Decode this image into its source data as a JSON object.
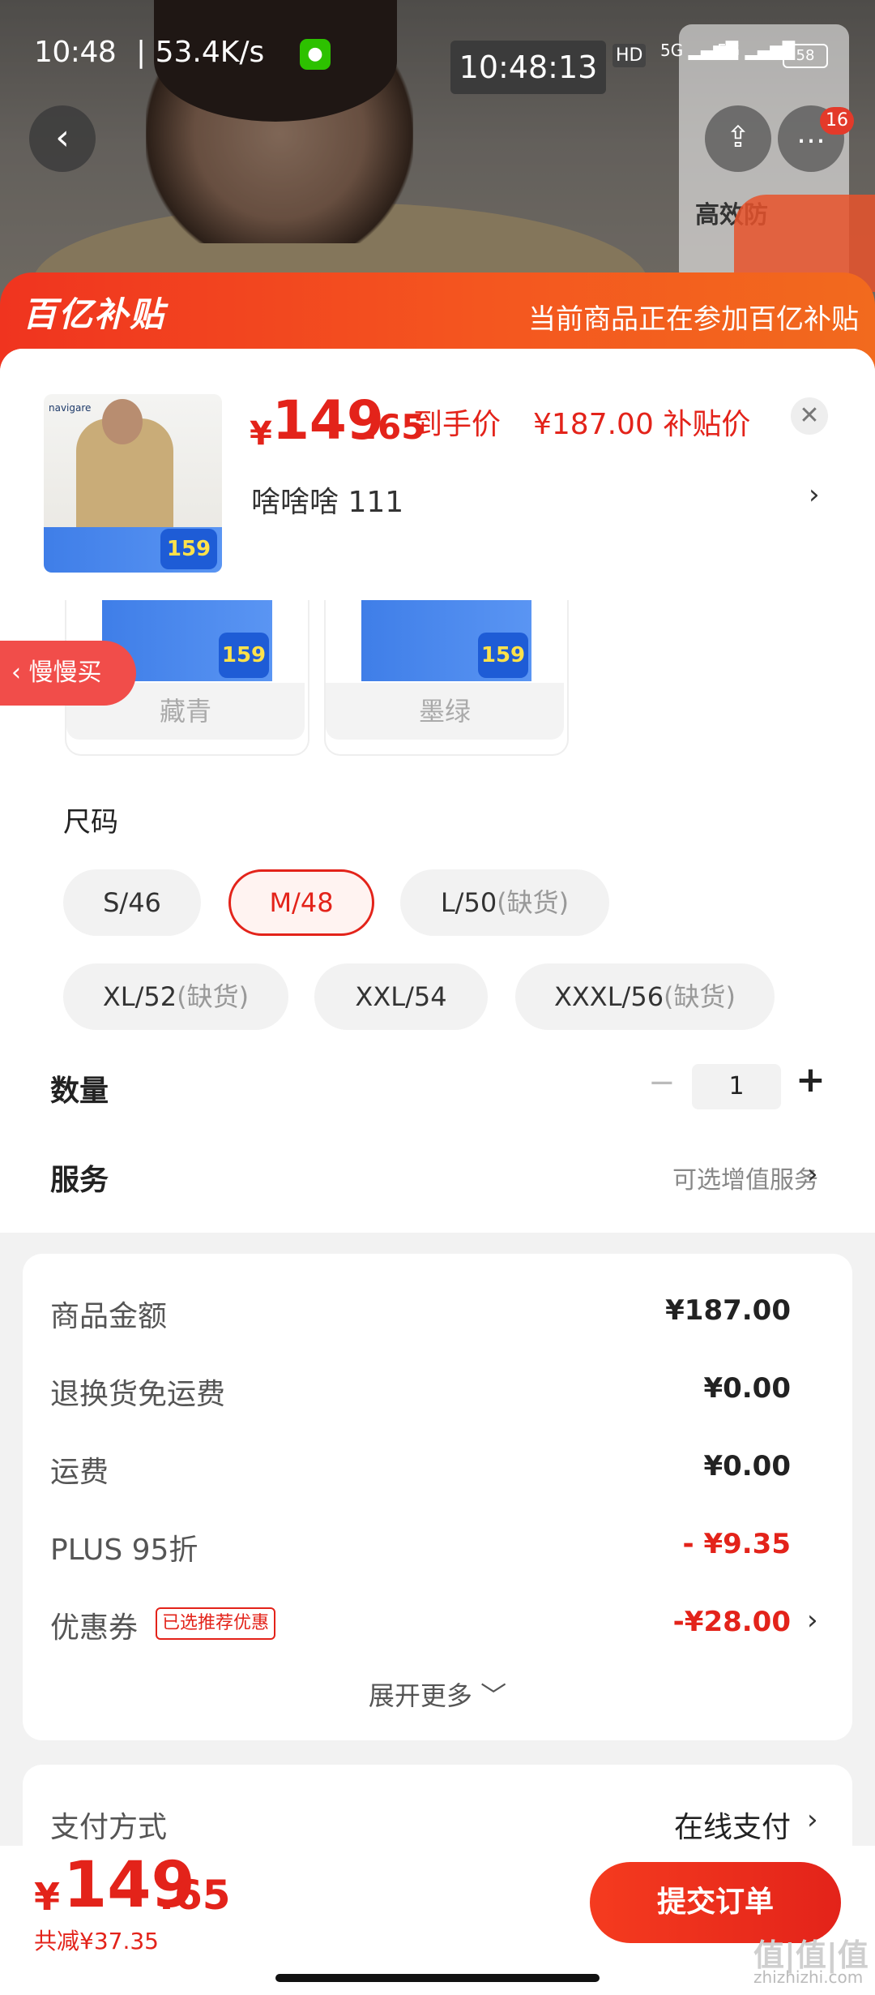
{
  "status_bar": {
    "time": "10:48",
    "network_speed": "| 53.4K/s ",
    "clock_overlay": "10:48:13",
    "hd_label": "HD",
    "signal_1": "5G",
    "signal_2": "5G",
    "battery": "58"
  },
  "background": {
    "promo_card_text": "高效防",
    "subsidy_badge": "百亿补贴",
    "notification_count": "16"
  },
  "subsidy_banner": {
    "logo_text": "百亿补贴",
    "note": "当前商品正在参加百亿补贴"
  },
  "product": {
    "thumb_brand": "navigare",
    "thumb_price": "159",
    "price_currency": "¥",
    "price_int": "149",
    "price_dec": ".65",
    "price_label": "到手价",
    "subsidy_price": "¥187.00 补贴价",
    "variant_summary": "啥啥啥  111"
  },
  "colors": [
    {
      "label": "藏青",
      "badge_price": "159"
    },
    {
      "label": "墨绿",
      "badge_price": "159"
    }
  ],
  "slow_buy_tag": "慢慢买",
  "size": {
    "heading": "尺码",
    "options": [
      {
        "label": "S/46",
        "oos": ""
      },
      {
        "label": "M/48",
        "oos": ""
      },
      {
        "label": "L/50",
        "oos": "(缺货)"
      },
      {
        "label": "XL/52",
        "oos": "(缺货)"
      },
      {
        "label": "XXL/54",
        "oos": ""
      },
      {
        "label": "XXXL/56",
        "oos": "(缺货)"
      }
    ],
    "selected": "M/48"
  },
  "quantity": {
    "label": "数量",
    "minus": "−",
    "value": "1",
    "plus": "+"
  },
  "service": {
    "label": "服务",
    "value": "可选增值服务"
  },
  "costs": [
    {
      "label": "商品金额",
      "value": "¥187.00"
    },
    {
      "label": "退换货免运费",
      "value": "¥0.00"
    },
    {
      "label": "运费",
      "value": "¥0.00"
    },
    {
      "label": "PLUS 95折",
      "value": "- ¥9.35"
    },
    {
      "label": "优惠券",
      "value": "-¥28.00"
    }
  ],
  "coupon_tag": "已选推荐优惠",
  "expand_more": "展开更多 ﹀",
  "payment": {
    "label": "支付方式",
    "value": "在线支付"
  },
  "bottom_bar": {
    "currency": "¥",
    "total_int": "149",
    "total_dec": ".65",
    "saving": "共减¥37.35",
    "submit": "提交订单"
  },
  "watermark": {
    "logo": "值|值|值",
    "site": "zhizhizhi.com"
  },
  "icons": {
    "back": "chevron-left-icon",
    "share": "share-icon",
    "more": "more-icon",
    "close": "close-icon",
    "arrow": "chevron-right-icon"
  },
  "colors_theme": {
    "accent_red": "#e3231a",
    "banner_orange": "#f4561f"
  }
}
